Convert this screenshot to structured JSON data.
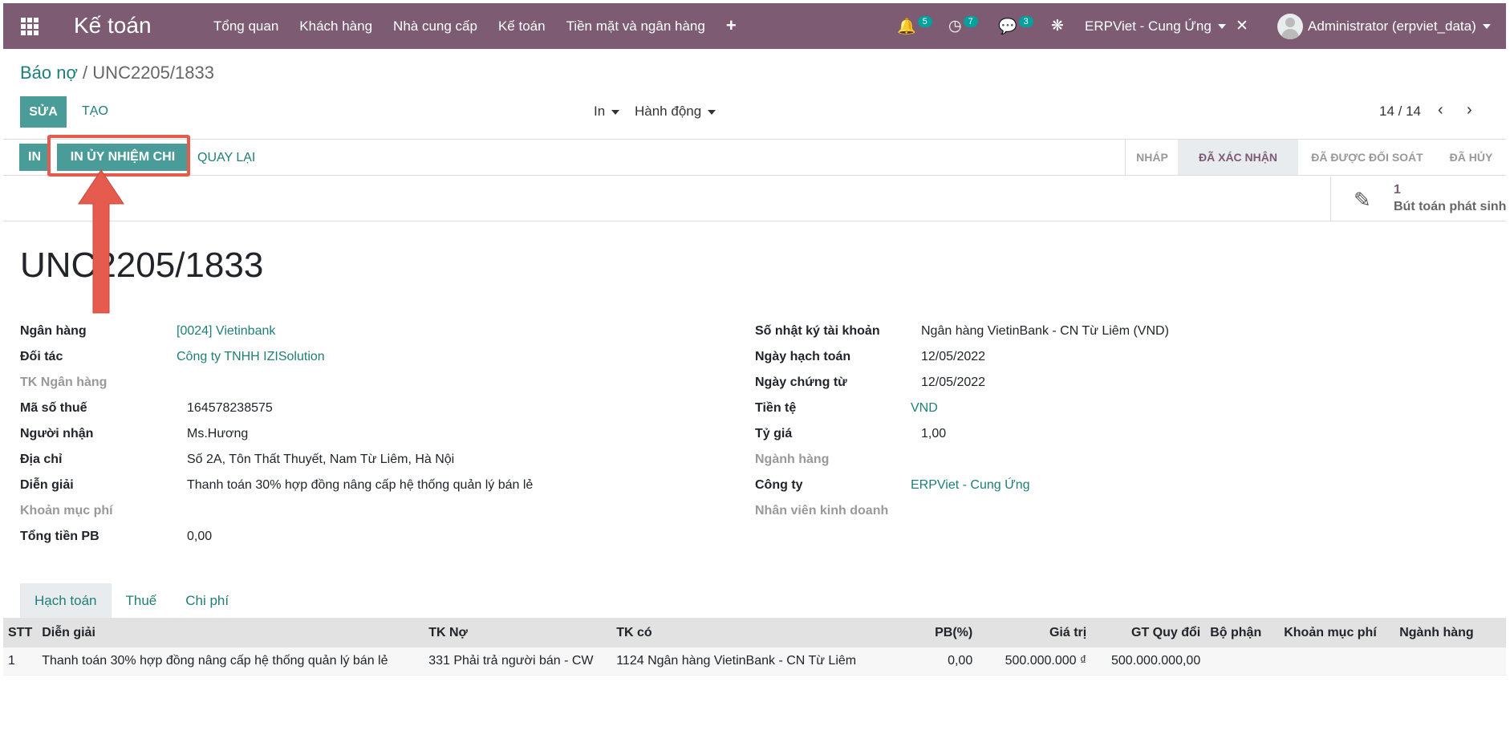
{
  "topbar": {
    "brand": "Kế toán",
    "menu": [
      "Tổng quan",
      "Khách hàng",
      "Nhà cung cấp",
      "Kế toán",
      "Tiền mặt và ngân hàng"
    ],
    "plus": "+",
    "notifications": {
      "bell": "5",
      "activities": "7",
      "messages": "3"
    },
    "company": "ERPViet - Cung Ứng",
    "user": "Administrator (erpviet_data)"
  },
  "breadcrumb": {
    "parent": "Báo nợ",
    "sep": "/",
    "current": "UNC2205/1833"
  },
  "controls": {
    "edit": "SỬA",
    "create": "TẠO",
    "print": "In",
    "action": "Hành động",
    "pager": "14 / 14"
  },
  "status_actions": {
    "print": "IN",
    "print_order": "IN ỦY NHIỆM CHI",
    "back": "QUAY LẠI"
  },
  "stages": [
    {
      "label": "NHÁP",
      "active": false
    },
    {
      "label": "ĐÃ XÁC NHẬN",
      "active": true
    },
    {
      "label": "ĐÃ ĐƯỢC ĐỐI SOÁT",
      "active": false
    },
    {
      "label": "ĐÃ HỦY",
      "active": false
    }
  ],
  "smart_button": {
    "count": "1",
    "label": "Bút toán phát sinh"
  },
  "doc": {
    "title": "UNC2205/1833",
    "left": [
      {
        "label": "Ngân hàng",
        "value": "[0024] Vietinbank",
        "link": true,
        "muted": false
      },
      {
        "label": "Đối tác",
        "value": "Công ty TNHH IZISolution",
        "link": true,
        "muted": false
      },
      {
        "label": "TK Ngân hàng",
        "value": "",
        "link": false,
        "muted": true
      },
      {
        "label": "Mã số thuế",
        "value": "164578238575",
        "link": false,
        "muted": false
      },
      {
        "label": "Người nhận",
        "value": "Ms.Hương",
        "link": false,
        "muted": false
      },
      {
        "label": "Địa chỉ",
        "value": "Số 2A, Tôn Thất Thuyết, Nam Từ Liêm, Hà Nội",
        "link": false,
        "muted": false
      },
      {
        "label": "Diễn giải",
        "value": "Thanh toán 30% hợp đồng nâng cấp hệ thống quản lý bán lẻ",
        "link": false,
        "muted": false
      },
      {
        "label": "Khoản mục phí",
        "value": "",
        "link": false,
        "muted": true
      },
      {
        "label": "Tổng tiền PB",
        "value": "0,00",
        "link": false,
        "muted": false
      }
    ],
    "right": [
      {
        "label": "Số nhật ký tài khoản",
        "value": "Ngân hàng VietinBank - CN Từ Liêm (VND)",
        "link": false,
        "muted": false
      },
      {
        "label": "Ngày hạch toán",
        "value": "12/05/2022",
        "link": false,
        "muted": false
      },
      {
        "label": "Ngày chứng từ",
        "value": "12/05/2022",
        "link": false,
        "muted": false
      },
      {
        "label": "Tiền tệ",
        "value": "VND",
        "link": true,
        "muted": false
      },
      {
        "label": "Tỷ giá",
        "value": "1,00",
        "link": false,
        "muted": false
      },
      {
        "label": "Ngành hàng",
        "value": "",
        "link": false,
        "muted": true
      },
      {
        "label": "Công ty",
        "value": "ERPViet - Cung Ứng",
        "link": true,
        "muted": false
      },
      {
        "label": "Nhân viên kinh doanh",
        "value": "",
        "link": false,
        "muted": true
      }
    ]
  },
  "tabs": [
    {
      "label": "Hạch toán",
      "active": true
    },
    {
      "label": "Thuế",
      "active": false
    },
    {
      "label": "Chi phí",
      "active": false
    }
  ],
  "table": {
    "headers": [
      "STT",
      "Diễn giải",
      "TK Nợ",
      "TK có",
      "PB(%)",
      "Giá trị",
      "GT Quy đổi",
      "Bộ phận",
      "Khoản mục phí",
      "Ngành hàng"
    ],
    "rows": [
      [
        "1",
        "Thanh toán 30% hợp đồng nâng cấp hệ thống quản lý bán lẻ",
        "331 Phải trả người bán - CW",
        "1124 Ngân hàng VietinBank - CN Từ Liêm",
        "0,00",
        "500.000.000 ₫",
        "500.000.000,00",
        "",
        "",
        ""
      ]
    ]
  },
  "colors": {
    "brand": "#7c5b73",
    "primary": "#4a9c98",
    "link": "#1f7e78",
    "highlight": "#e55b4d"
  }
}
